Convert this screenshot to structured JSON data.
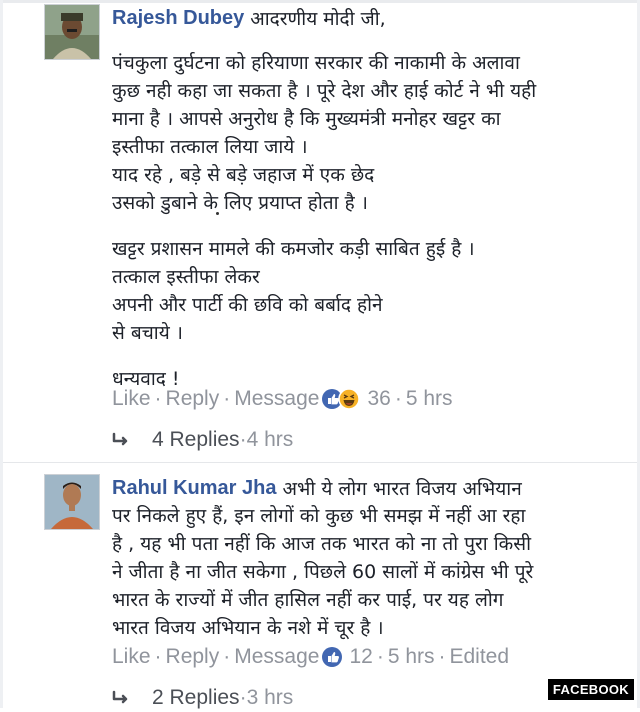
{
  "comments": [
    {
      "author": "Rajesh Dubey",
      "intro": "आदरणीय मोदी जी,",
      "lines_block1": [
        "पंचकुला दुर्घटना को हरियाणा सरकार की नाकामी के अलावा",
        "कुछ नही कहा जा सकता है । पूरे देश और हाई कोर्ट ने भी यही",
        "माना है । आपसे अनुरोध है कि मुख्यमंत्री मनोहर खट्टर का",
        "इस्तीफा तत्काल लिया जाये ।",
        "याद रहे , बड़े से बड़े जहाज में एक छेद",
        "उसको डुबाने के लिए प्रयाप्त होता है ।"
      ],
      "lines_block2": [
        "खट्टर प्रशासन मामले की कमजोर कड़ी साबित हुई है ।",
        "तत्काल इस्तीफा लेकर",
        "अपनी और पार्टी की छवि को बर्बाद होने",
        "से बचाये ।"
      ],
      "lines_block3": [
        "धन्यवाद !"
      ],
      "actions": {
        "like": "Like",
        "reply": "Reply",
        "message": "Message",
        "reaction_count": "36",
        "time": "5 hrs"
      },
      "replies": {
        "count_label": "4 Replies",
        "time": "4 hrs"
      }
    },
    {
      "author": "Rahul Kumar Jha",
      "intro": "अभी ये लोग भारत विजय अभियान",
      "lines_block1": [
        "पर निकले हुए हैं, इन लोगों को कुछ भी समझ में नहीं आ रहा",
        "है , यह भी पता नहीं कि आज तक भारत को ना तो पुरा किसी",
        "ने जीता है ना जीत सकेगा , पिछले 60 सालों में कांग्रेस भी पूरे",
        "भारत के राज्यों में जीत हासिल नहीं कर पाई, पर यह लोग",
        "भारत विजय अभियान के नशे में चूर है ।"
      ],
      "actions": {
        "like": "Like",
        "reply": "Reply",
        "message": "Message",
        "reaction_count": "12",
        "time": "5 hrs",
        "edited": "Edited"
      },
      "replies": {
        "count_label": "2 Replies",
        "time": "3 hrs"
      }
    }
  ],
  "separator": "·",
  "watermark": "FACEBOOK",
  "colors": {
    "author_blue": "#365899",
    "meta_grey": "#90949c",
    "like_blue": "#4267b2",
    "haha_yellow": "#f7b125"
  },
  "icons": {
    "reply_arrow": "reply-arrow-icon",
    "like_reaction": "like-reaction-icon",
    "haha_reaction": "haha-reaction-icon"
  }
}
